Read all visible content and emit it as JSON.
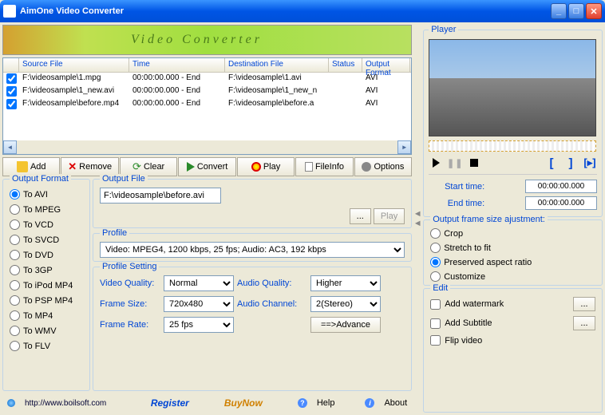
{
  "window": {
    "title": "AimOne Video Converter"
  },
  "banner": {
    "text": "Video Converter"
  },
  "table": {
    "headers": {
      "src": "Source File",
      "time": "Time",
      "dst": "Destination File",
      "status": "Status",
      "fmt": "Output Format"
    },
    "rows": [
      {
        "src": "F:\\videosample\\1.mpg",
        "time": "00:00:00.000 - End",
        "dst": "F:\\videosample\\1.avi",
        "status": "",
        "fmt": "AVI"
      },
      {
        "src": "F:\\videosample\\1_new.avi",
        "time": "00:00:00.000 - End",
        "dst": "F:\\videosample\\1_new_n",
        "status": "",
        "fmt": "AVI"
      },
      {
        "src": "F:\\videosample\\before.mp4",
        "time": "00:00:00.000 - End",
        "dst": "F:\\videosample\\before.a",
        "status": "",
        "fmt": "AVI"
      }
    ]
  },
  "toolbar": {
    "add": "Add",
    "remove": "Remove",
    "clear": "Clear",
    "convert": "Convert",
    "play": "Play",
    "fileinfo": "FileInfo",
    "options": "Options"
  },
  "output_format": {
    "title": "Output Format",
    "options": [
      "To AVI",
      "To MPEG",
      "To VCD",
      "To SVCD",
      "To DVD",
      "To 3GP",
      "To iPod MP4",
      "To PSP MP4",
      "To MP4",
      "To WMV",
      "To FLV"
    ],
    "selected": "To AVI"
  },
  "output_file": {
    "title": "Output File",
    "value": "F:\\videosample\\before.avi",
    "browse": "...",
    "play": "Play"
  },
  "profile": {
    "title": "Profile",
    "value": "Video: MPEG4, 1200 kbps, 25 fps;  Audio: AC3, 192 kbps"
  },
  "profile_setting": {
    "title": "Profile Setting",
    "video_quality_label": "Video Quality:",
    "video_quality": "Normal",
    "frame_size_label": "Frame Size:",
    "frame_size": "720x480",
    "frame_rate_label": "Frame Rate:",
    "frame_rate": "25 fps",
    "audio_quality_label": "Audio Quality:",
    "audio_quality": "Higher",
    "audio_channel_label": "Audio Channel:",
    "audio_channel": "2(Stereo)",
    "advance": "==>Advance"
  },
  "player": {
    "title": "Player",
    "start_label": "Start time:",
    "start_value": "00:00:00.000",
    "end_label": "End  time:",
    "end_value": "00:00:00.000"
  },
  "frame_adjust": {
    "title": "Output frame size ajustment:",
    "options": [
      "Crop",
      "Stretch to fit",
      "Preserved aspect ratio",
      "Customize"
    ],
    "selected": "Preserved aspect ratio"
  },
  "edit": {
    "title": "Edit",
    "watermark": "Add watermark",
    "subtitle": "Add Subtitle",
    "flip": "Flip video"
  },
  "footer": {
    "url": "http://www.boilsoft.com",
    "register": "Register",
    "buy": "BuyNow",
    "help": "Help",
    "about": "About"
  }
}
